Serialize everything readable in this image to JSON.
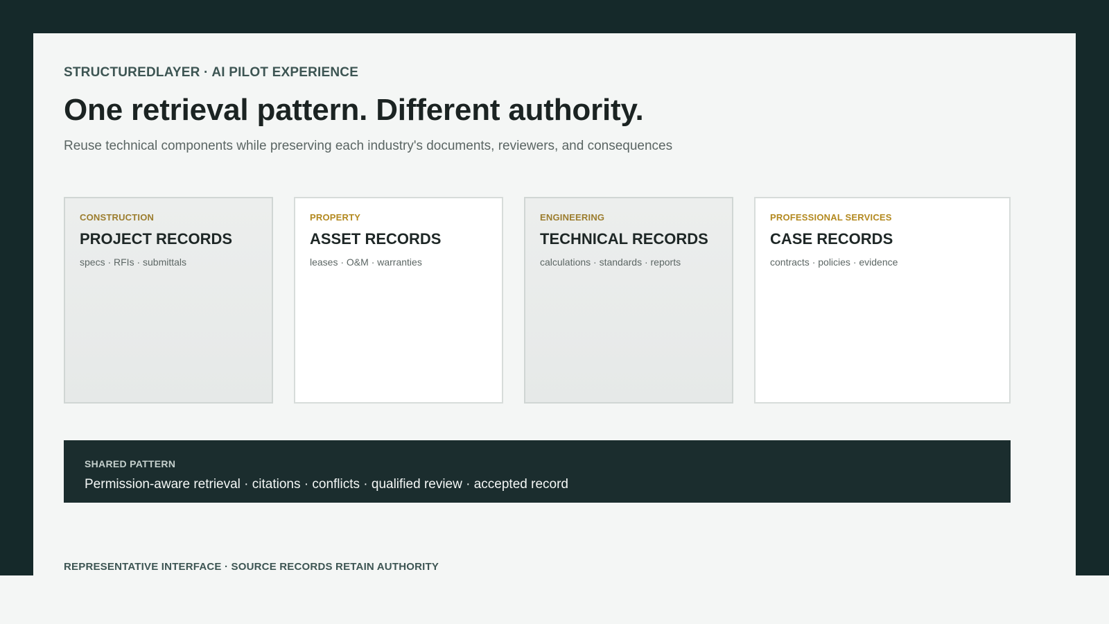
{
  "header": {
    "eyebrow": "STRUCTUREDLAYER · AI PILOT EXPERIENCE",
    "title": "One retrieval pattern. Different authority.",
    "subtitle": "Reuse technical components while preserving each industry's documents, reviewers, and consequences"
  },
  "cards": [
    {
      "tag": "CONSTRUCTION",
      "title": "PROJECT RECORDS",
      "items": "specs · RFIs · submittals"
    },
    {
      "tag": "PROPERTY",
      "title": "ASSET RECORDS",
      "items": "leases · O&M · warranties"
    },
    {
      "tag": "ENGINEERING",
      "title": "TECHNICAL RECORDS",
      "items": "calculations · standards · reports"
    },
    {
      "tag": "PROFESSIONAL SERVICES",
      "title": "CASE RECORDS",
      "items": "contracts · policies · evidence"
    }
  ],
  "shared": {
    "label": "SHARED PATTERN",
    "text": "Permission-aware retrieval · citations · conflicts · qualified review · accepted record"
  },
  "footer": {
    "text": "REPRESENTATIVE INTERFACE · SOURCE RECORDS RETAIN AUTHORITY"
  }
}
